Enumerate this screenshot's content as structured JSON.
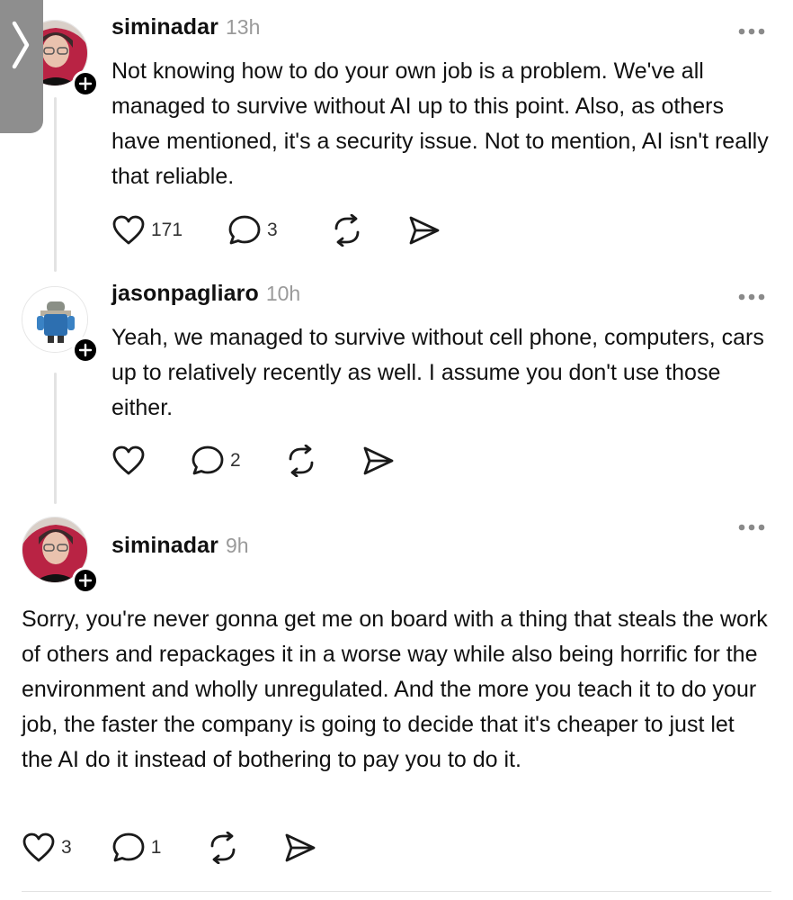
{
  "posts": [
    {
      "username": "siminadar",
      "time": "13h",
      "text": "Not knowing how to do your own job is a problem. We've all managed to survive without AI up to this point. Also, as others have mentioned, it's a security issue. Not to mention, AI isn't really that reliable.",
      "likes": "171",
      "replies": "3",
      "avatar_icon": "person-photo-avatar"
    },
    {
      "username": "jasonpagliaro",
      "time": "10h",
      "text": "Yeah, we managed to survive without cell phone, computers, cars up to relatively recently as well. I assume you don't use those either.",
      "likes": "",
      "replies": "2",
      "avatar_icon": "robot-avatar"
    },
    {
      "username": "siminadar",
      "time": "9h",
      "text": "Sorry, you're never gonna get me on board with a thing that steals the work of others and repackages it in a worse way while also being horrific for the environment and wholly unregulated. And the more you teach it to do your job, the faster the company is going to decide that it's cheaper to just let the AI do it instead of bothering to pay you to do it.",
      "likes": "3",
      "replies": "1",
      "avatar_icon": "person-photo-avatar"
    }
  ],
  "colors": {
    "text": "#111111",
    "muted": "#9a9a9a",
    "thread_line": "#e3e3e3",
    "side_tab": "#8e8e8e"
  }
}
